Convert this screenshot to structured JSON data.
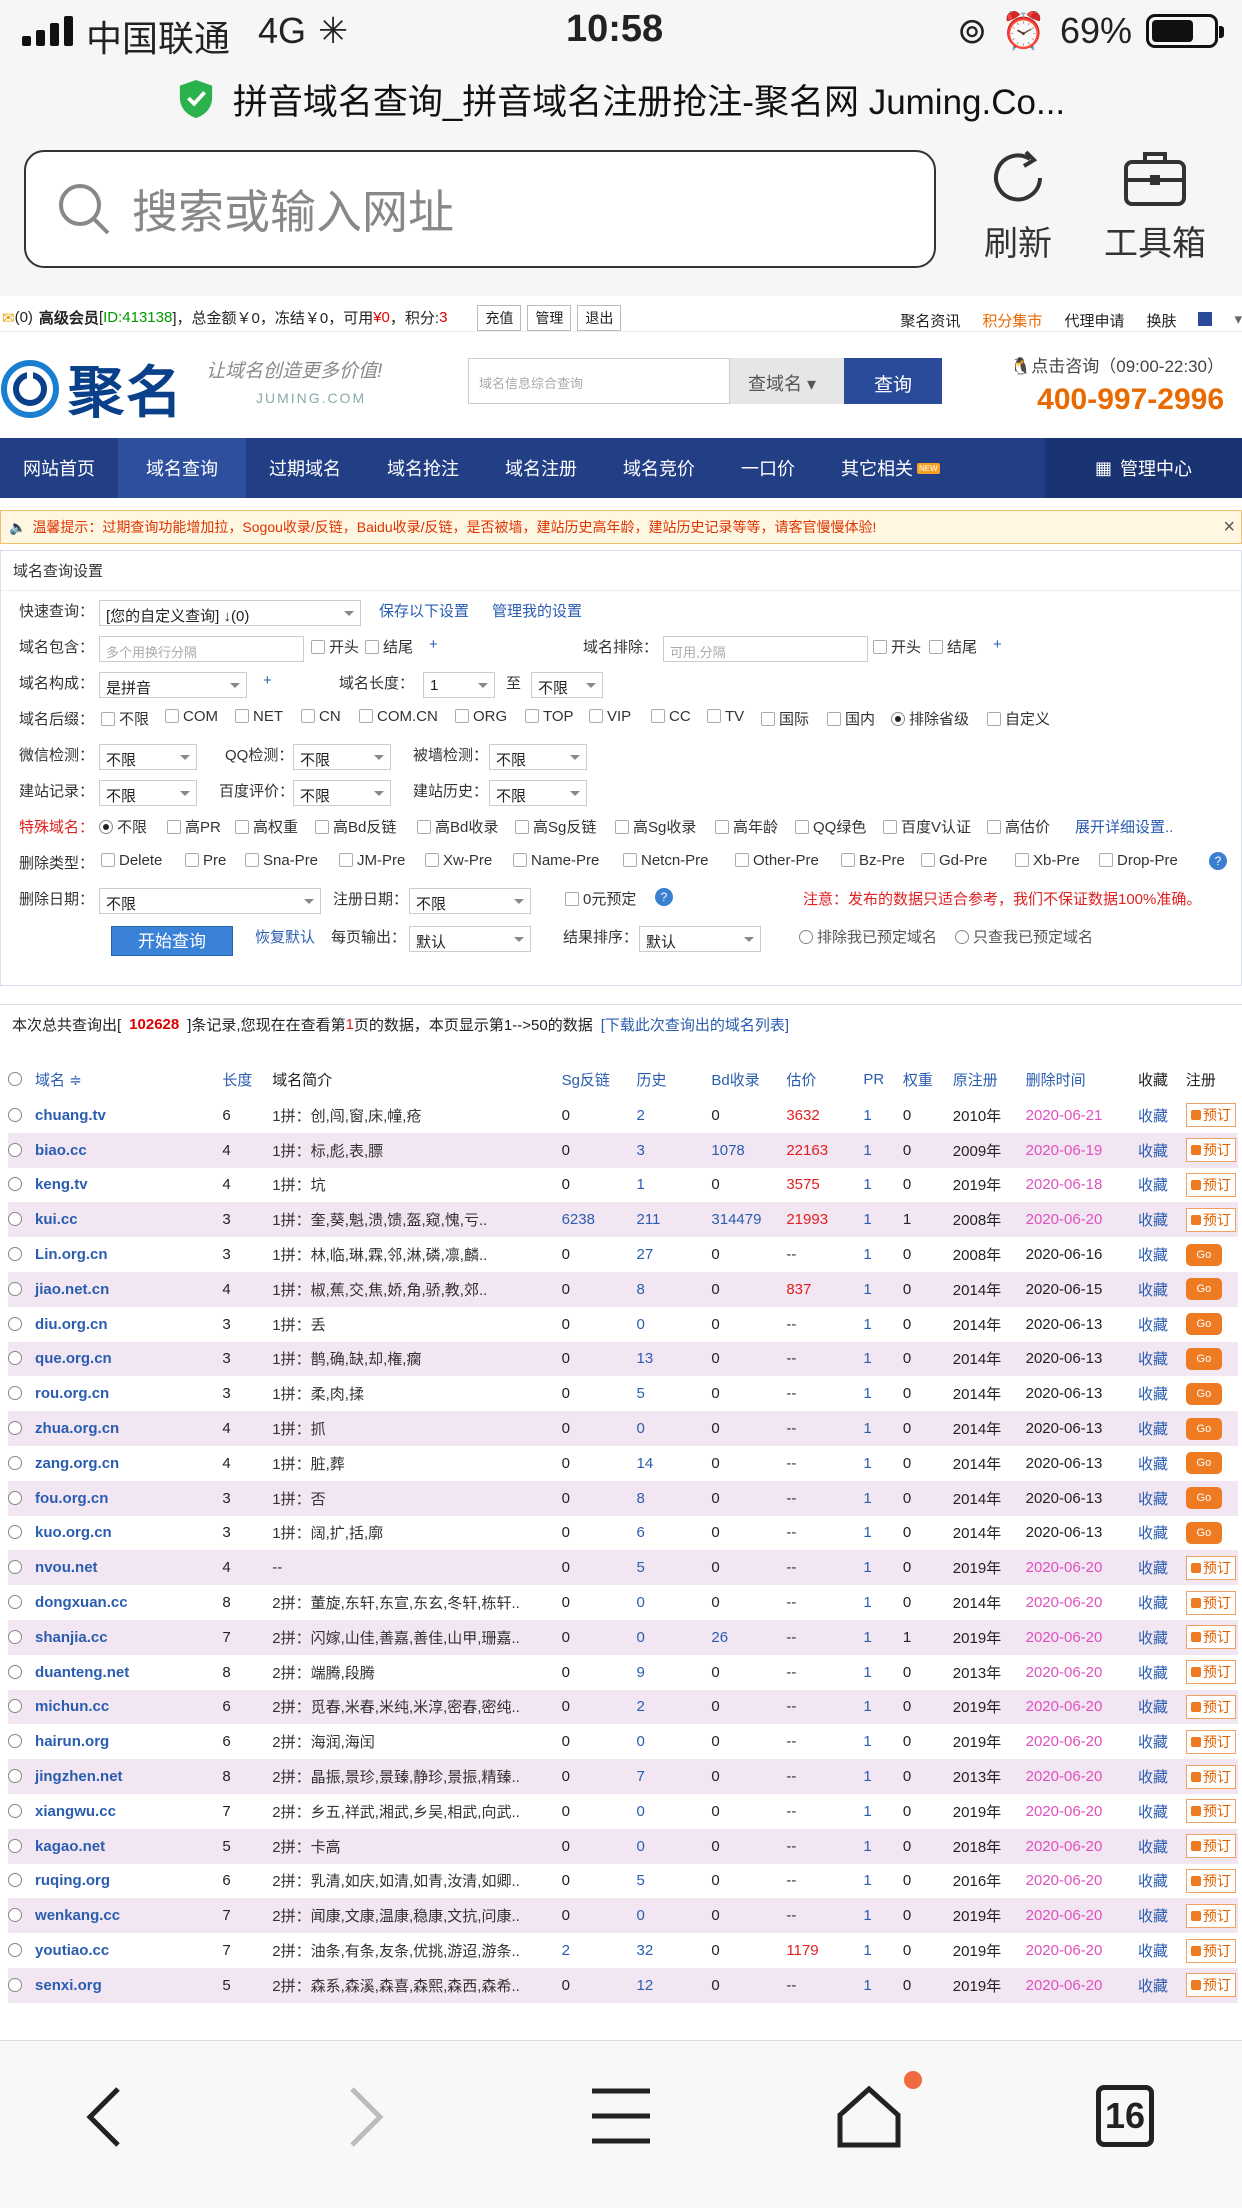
{
  "status_bar": {
    "carrier": "中国联通",
    "network": "4G",
    "time": "10:58",
    "battery": "69%"
  },
  "browser": {
    "page_title": "拼音域名查询_拼音域名注册抢注-聚名网 Juming.Co...",
    "search_placeholder": "搜索或输入网址",
    "refresh_label": "刷新",
    "toolbox_label": "工具箱",
    "tab_count": "16"
  },
  "topbar": {
    "msg_count": "(0)",
    "member": "高级会员",
    "id": "ID:413138",
    "balance_label": "总金额￥0，冻结￥0，可用",
    "avail": "¥0",
    "points_label": "，积分:",
    "points": "3",
    "btn_recharge": "充值",
    "btn_manage": "管理",
    "btn_logout": "退出",
    "links": [
      "聚名资讯",
      "积分集市",
      "代理申请",
      "换肤"
    ]
  },
  "header": {
    "logo": "聚名",
    "slogan": "让域名创造更多价值!",
    "slogan_sub": "JUMING.COM",
    "search_placeholder": "域名信息综合查询",
    "search_type": "查域名",
    "search_btn": "查询",
    "contact": "点击咨询（09:00-22:30）",
    "phone": "400-997-2996"
  },
  "nav": {
    "items": [
      "网站首页",
      "域名查询",
      "过期域名",
      "域名抢注",
      "域名注册",
      "域名竞价",
      "一口价",
      "其它相关"
    ],
    "new_badge": "NEW",
    "manage": "管理中心"
  },
  "notice": {
    "text": "温馨提示：过期查询功能增加拉，Sogou收录/反链，Baidu收录/反链，是否被墙，建站历史高年龄，建站历史记录等等，请客官慢慢体验!",
    "close": "×"
  },
  "filters": {
    "title": "域名查询设置",
    "quick_label": "快速查询：",
    "quick_value": "[您的自定义查询] ↓(0)",
    "save": "保存以下设置",
    "manage": "管理我的设置",
    "include_label": "域名包含：",
    "include_ph": "多个用换行分隔",
    "kaitou": "开头",
    "jiewei": "结尾",
    "plus": "+",
    "exclude_label": "域名排除：",
    "exclude_ph": "可用,分隔",
    "compose_label": "域名构成：",
    "compose_value": "是拼音",
    "len_label": "域名长度：",
    "len_min": "1",
    "to": "至",
    "len_max": "不限",
    "suffix_label": "域名后缀：",
    "suffixes": [
      "不限",
      "COM",
      "NET",
      "CN",
      "COM.CN",
      "ORG",
      "TOP",
      "VIP",
      "CC",
      "TV",
      "国际",
      "国内",
      "排除省级",
      "自定义"
    ],
    "wechat_label": "微信检测：",
    "wechat": "不限",
    "qq_label": "QQ检测：",
    "qq": "不限",
    "wall_label": "被墙检测：",
    "wall": "不限",
    "site_label": "建站记录：",
    "site": "不限",
    "baidu_label": "百度评价：",
    "baidu": "不限",
    "hist_label": "建站历史：",
    "hist": "不限",
    "special_label": "特殊域名：",
    "specials": [
      "不限",
      "高PR",
      "高权重",
      "高Bd反链",
      "高Bd收录",
      "高Sg反链",
      "高Sg收录",
      "高年龄",
      "QQ绿色",
      "百度V认证",
      "高估价"
    ],
    "expand": "展开详细设置..",
    "deltype_label": "删除类型：",
    "deltypes": [
      "Delete",
      "Pre",
      "Sna-Pre",
      "JM-Pre",
      "Xw-Pre",
      "Name-Pre",
      "Netcn-Pre",
      "Other-Pre",
      "Bz-Pre",
      "Gd-Pre",
      "Xb-Pre",
      "Drop-Pre"
    ],
    "deldate_label": "删除日期：",
    "deldate": "不限",
    "regdate_label": "注册日期：",
    "regdate": "不限",
    "zero": "0元预定",
    "help": "?",
    "warn": "注意：发布的数据只适合参考，我们不保证数据100%准确。",
    "start": "开始查询",
    "reset": "恢复默认",
    "perpage_label": "每页输出：",
    "perpage": "默认",
    "sort_label": "结果排序：",
    "sort": "默认",
    "excl_booked": "排除我已预定域名",
    "only_booked": "只查我已预定域名"
  },
  "summary": {
    "pre": "本次总共查询出[",
    "count": "102628",
    "mid": "]条记录,您现在在查看第",
    "page": "1",
    "post": "页的数据，本页显示第1-->50的数据",
    "download": "[下载此次查询出的域名列表]"
  },
  "table": {
    "headers": [
      "域名 ≑",
      "长度",
      "域名简介",
      "Sg反链",
      "历史",
      "Bd收录",
      "估价",
      "PR",
      "权重",
      "原注册",
      "删除时间",
      "收藏",
      "注册"
    ],
    "fav": "收藏",
    "go": "Go",
    "book": "预订",
    "rows": [
      [
        "chuang.tv",
        "6",
        "1拼：创,闯,窗,床,幢,疮",
        "0",
        "2",
        "0",
        "3632",
        "1",
        "0",
        "2010年",
        "2020-06-21",
        "book"
      ],
      [
        "biao.cc",
        "4",
        "1拼：标,彪,表,膘",
        "0",
        "3",
        "1078",
        "22163",
        "1",
        "0",
        "2009年",
        "2020-06-19",
        "book"
      ],
      [
        "keng.tv",
        "4",
        "1拼：坑",
        "0",
        "1",
        "0",
        "3575",
        "1",
        "0",
        "2019年",
        "2020-06-18",
        "book"
      ],
      [
        "kui.cc",
        "3",
        "1拼：奎,葵,魁,溃,馈,盔,窥,愧,亏..",
        "6238",
        "211",
        "314479",
        "21993",
        "1",
        "1",
        "2008年",
        "2020-06-20",
        "book"
      ],
      [
        "Lin.org.cn",
        "3",
        "1拼：林,临,琳,霖,邻,淋,磷,凛,麟..",
        "0",
        "27",
        "0",
        "--",
        "1",
        "0",
        "2008年",
        "2020-06-16",
        "go"
      ],
      [
        "jiao.net.cn",
        "4",
        "1拼：椒,蕉,交,焦,娇,角,骄,教,郊..",
        "0",
        "8",
        "0",
        "837",
        "1",
        "0",
        "2014年",
        "2020-06-15",
        "go"
      ],
      [
        "diu.org.cn",
        "3",
        "1拼：丢",
        "0",
        "0",
        "0",
        "--",
        "1",
        "0",
        "2014年",
        "2020-06-13",
        "go"
      ],
      [
        "que.org.cn",
        "3",
        "1拼：鹊,确,缺,却,権,瘸",
        "0",
        "13",
        "0",
        "--",
        "1",
        "0",
        "2014年",
        "2020-06-13",
        "go"
      ],
      [
        "rou.org.cn",
        "3",
        "1拼：柔,肉,揉",
        "0",
        "5",
        "0",
        "--",
        "1",
        "0",
        "2014年",
        "2020-06-13",
        "go"
      ],
      [
        "zhua.org.cn",
        "4",
        "1拼：抓",
        "0",
        "0",
        "0",
        "--",
        "1",
        "0",
        "2014年",
        "2020-06-13",
        "go"
      ],
      [
        "zang.org.cn",
        "4",
        "1拼：脏,葬",
        "0",
        "14",
        "0",
        "--",
        "1",
        "0",
        "2014年",
        "2020-06-13",
        "go"
      ],
      [
        "fou.org.cn",
        "3",
        "1拼：否",
        "0",
        "8",
        "0",
        "--",
        "1",
        "0",
        "2014年",
        "2020-06-13",
        "go"
      ],
      [
        "kuo.org.cn",
        "3",
        "1拼：阔,扩,括,廓",
        "0",
        "6",
        "0",
        "--",
        "1",
        "0",
        "2014年",
        "2020-06-13",
        "go"
      ],
      [
        "nvou.net",
        "4",
        "--",
        "0",
        "5",
        "0",
        "--",
        "1",
        "0",
        "2019年",
        "2020-06-20",
        "book"
      ],
      [
        "dongxuan.cc",
        "8",
        "2拼：董旋,东轩,东宣,东玄,冬轩,栋轩..",
        "0",
        "0",
        "0",
        "--",
        "1",
        "0",
        "2014年",
        "2020-06-20",
        "book"
      ],
      [
        "shanjia.cc",
        "7",
        "2拼：闪嫁,山佳,善嘉,善佳,山甲,珊嘉..",
        "0",
        "0",
        "26",
        "--",
        "1",
        "1",
        "2019年",
        "2020-06-20",
        "book"
      ],
      [
        "duanteng.net",
        "8",
        "2拼：端腾,段腾",
        "0",
        "9",
        "0",
        "--",
        "1",
        "0",
        "2013年",
        "2020-06-20",
        "book"
      ],
      [
        "michun.cc",
        "6",
        "2拼：觅春,米春,米纯,米淳,密春,密纯..",
        "0",
        "2",
        "0",
        "--",
        "1",
        "0",
        "2019年",
        "2020-06-20",
        "book"
      ],
      [
        "hairun.org",
        "6",
        "2拼：海润,海闰",
        "0",
        "0",
        "0",
        "--",
        "1",
        "0",
        "2019年",
        "2020-06-20",
        "book"
      ],
      [
        "jingzhen.net",
        "8",
        "2拼：晶振,景珍,景臻,静珍,景振,精臻..",
        "0",
        "7",
        "0",
        "--",
        "1",
        "0",
        "2013年",
        "2020-06-20",
        "book"
      ],
      [
        "xiangwu.cc",
        "7",
        "2拼：乡五,祥武,湘武,乡吴,相武,向武..",
        "0",
        "0",
        "0",
        "--",
        "1",
        "0",
        "2019年",
        "2020-06-20",
        "book"
      ],
      [
        "kagao.net",
        "5",
        "2拼：卡高",
        "0",
        "0",
        "0",
        "--",
        "1",
        "0",
        "2018年",
        "2020-06-20",
        "book"
      ],
      [
        "ruqing.org",
        "6",
        "2拼：乳清,如庆,如清,如青,汝清,如卿..",
        "0",
        "5",
        "0",
        "--",
        "1",
        "0",
        "2016年",
        "2020-06-20",
        "book"
      ],
      [
        "wenkang.cc",
        "7",
        "2拼：闻康,文康,温康,稳康,文抗,问康..",
        "0",
        "0",
        "0",
        "--",
        "1",
        "0",
        "2019年",
        "2020-06-20",
        "book"
      ],
      [
        "youtiao.cc",
        "7",
        "2拼：油条,有条,友条,优挑,游迢,游条..",
        "2",
        "32",
        "0",
        "1179",
        "1",
        "0",
        "2019年",
        "2020-06-20",
        "book"
      ],
      [
        "senxi.org",
        "5",
        "2拼：森系,森溪,森喜,森熙,森西,森希..",
        "0",
        "12",
        "0",
        "--",
        "1",
        "0",
        "2019年",
        "2020-06-20",
        "book"
      ]
    ]
  }
}
